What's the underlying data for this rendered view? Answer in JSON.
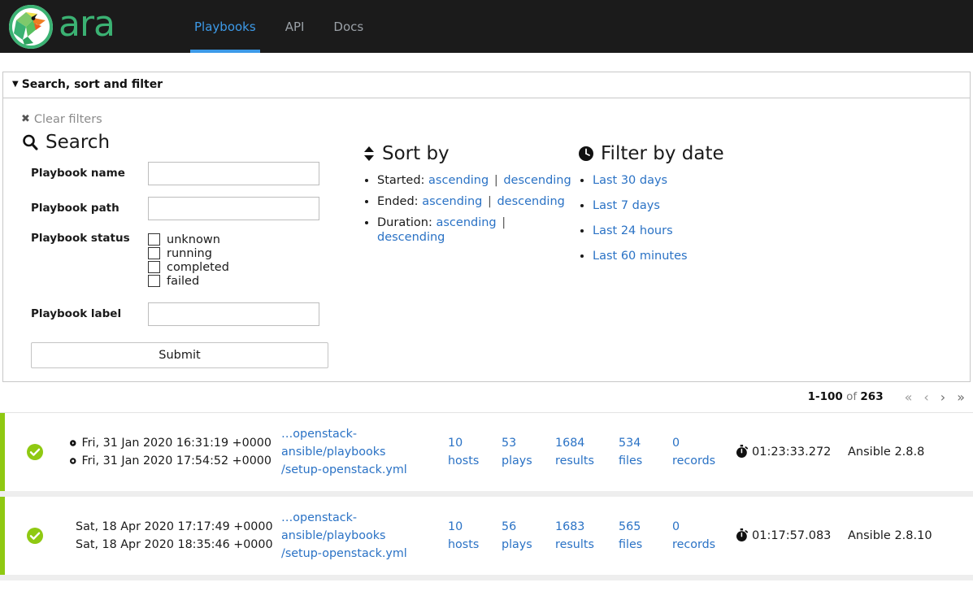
{
  "navbar": {
    "brand_name": "ara",
    "logo_icon": "parrot-logo-icon",
    "brand_color": "#3bb273",
    "accent_color": "#3d9ae8",
    "links": [
      {
        "label": "Playbooks",
        "active": true
      },
      {
        "label": "API",
        "active": false
      },
      {
        "label": "Docs",
        "active": false
      }
    ]
  },
  "panel": {
    "title": "Search, sort and filter",
    "caret_icon": "caret-down-icon",
    "clear_filters": {
      "label": "Clear filters",
      "icon": "x-icon"
    },
    "search": {
      "heading": "Search",
      "heading_icon": "magnifier-icon",
      "fields": [
        {
          "label": "Playbook name",
          "value": "",
          "placeholder": ""
        },
        {
          "label": "Playbook path",
          "value": "",
          "placeholder": ""
        }
      ],
      "status": {
        "label": "Playbook status",
        "options": [
          {
            "label": "unknown",
            "checked": false
          },
          {
            "label": "running",
            "checked": false
          },
          {
            "label": "completed",
            "checked": false
          },
          {
            "label": "failed",
            "checked": false
          }
        ]
      },
      "label_field": {
        "label": "Playbook label",
        "value": "",
        "placeholder": ""
      },
      "submit_label": "Submit"
    },
    "sort": {
      "heading": "Sort by",
      "heading_icon": "sort-updown-icon",
      "rows": [
        {
          "label": "Started:",
          "asc": "ascending",
          "desc": "descending"
        },
        {
          "label": "Ended:",
          "asc": "ascending",
          "desc": "descending"
        },
        {
          "label": "Duration:",
          "asc": "ascending",
          "desc": "descending"
        }
      ],
      "separator": "|"
    },
    "date_filter": {
      "heading": "Filter by date",
      "heading_icon": "clock-icon",
      "items": [
        "Last 30 days",
        "Last 7 days",
        "Last 24 hours",
        "Last 60 minutes"
      ]
    }
  },
  "pagination": {
    "range": "1-100",
    "of_label": "of",
    "total": "263",
    "first_icon": "«",
    "prev_icon": "‹",
    "next_icon": "›",
    "last_icon": "»"
  },
  "playbooks": [
    {
      "status": "completed",
      "status_icon": "check-circle-icon",
      "accent_color": "#8fc912",
      "started": {
        "icon": "play-circle-icon",
        "text": "Fri, 31 Jan 2020 16:31:19 +0000"
      },
      "ended": {
        "icon": "stop-circle-icon",
        "text": "Fri, 31 Jan 2020 17:54:52 +0000"
      },
      "path_line1": "…openstack-ansible/playbooks",
      "path_line2": "/setup-openstack.yml",
      "stats": [
        {
          "value": "10",
          "label": "hosts"
        },
        {
          "value": "53",
          "label": "plays"
        },
        {
          "value": "1684",
          "label": "results"
        },
        {
          "value": "534",
          "label": "files"
        },
        {
          "value": "0",
          "label": "records"
        }
      ],
      "duration": "01:23:33.272",
      "duration_icon": "stopwatch-icon",
      "version": "Ansible 2.8.8"
    },
    {
      "status": "completed",
      "status_icon": "check-circle-icon",
      "accent_color": "#8fc912",
      "started": {
        "icon": "play-circle-icon",
        "text": "Sat, 18 Apr 2020 17:17:49 +0000"
      },
      "ended": {
        "icon": "stop-circle-icon",
        "text": "Sat, 18 Apr 2020 18:35:46 +0000"
      },
      "path_line1": "…openstack-ansible/playbooks",
      "path_line2": "/setup-openstack.yml",
      "stats": [
        {
          "value": "10",
          "label": "hosts"
        },
        {
          "value": "56",
          "label": "plays"
        },
        {
          "value": "1683",
          "label": "results"
        },
        {
          "value": "565",
          "label": "files"
        },
        {
          "value": "0",
          "label": "records"
        }
      ],
      "duration": "01:17:57.083",
      "duration_icon": "stopwatch-icon",
      "version": "Ansible 2.8.10"
    }
  ]
}
